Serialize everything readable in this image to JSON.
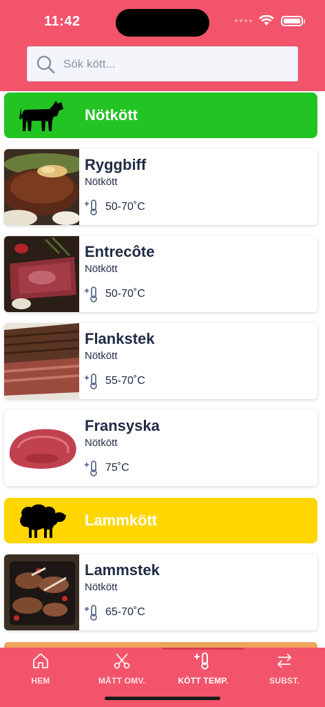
{
  "status_bar": {
    "time": "11:42"
  },
  "search": {
    "placeholder": "Sök kött..."
  },
  "categories": [
    {
      "label": "Nötkött",
      "color": "#22c423",
      "icon": "cow-icon"
    },
    {
      "label": "Lammkött",
      "color": "#ffd600",
      "icon": "sheep-icon"
    }
  ],
  "items": [
    {
      "title": "Ryggbiff",
      "category": "Nötkött",
      "temp": "50-70˚C"
    },
    {
      "title": "Entrecôte",
      "category": "Nötkött",
      "temp": "50-70˚C"
    },
    {
      "title": "Flankstek",
      "category": "Nötkött",
      "temp": "55-70˚C"
    },
    {
      "title": "Fransyska",
      "category": "Nötkött",
      "temp": "75˚C"
    },
    {
      "title": "Lammstek",
      "category": "Nötkött",
      "temp": "65-70˚C"
    }
  ],
  "tabs": [
    {
      "label": "HEM",
      "icon": "home-icon"
    },
    {
      "label": "MÅTT OMV.",
      "icon": "scissors-icon"
    },
    {
      "label": "KÖTT TEMP.",
      "icon": "thermometer-icon",
      "active": true
    },
    {
      "label": "SUBST.",
      "icon": "swap-arrows-icon"
    }
  ],
  "colors": {
    "brand": "#f2546b",
    "text": "#1f2a44"
  }
}
